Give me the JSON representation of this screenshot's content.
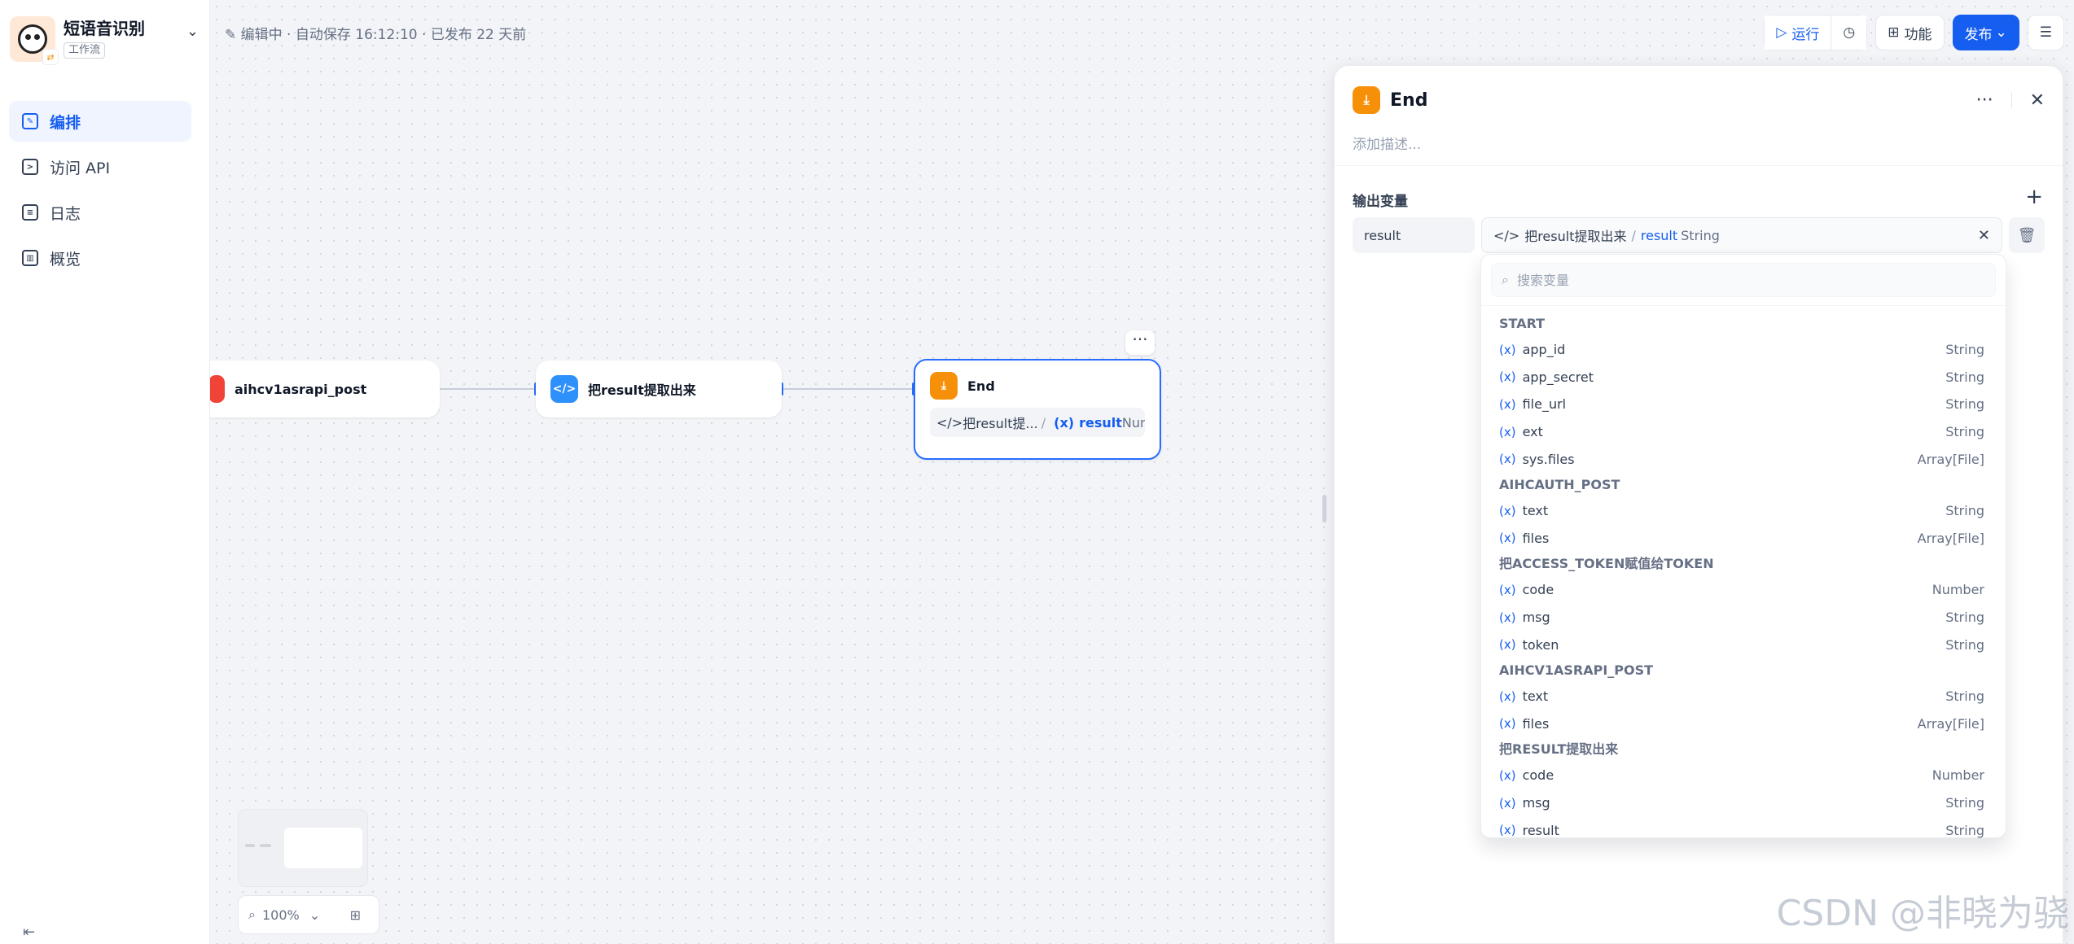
{
  "app": {
    "title": "短语音识别",
    "type_badge": "工作流"
  },
  "nav": [
    {
      "label": "编排",
      "icon": "orchestrate-icon",
      "active": true
    },
    {
      "label": "访问 API",
      "icon": "terminal-icon",
      "active": false
    },
    {
      "label": "日志",
      "icon": "log-icon",
      "active": false
    },
    {
      "label": "概览",
      "icon": "chart-icon",
      "active": false
    }
  ],
  "editor": {
    "status": "编辑中 · 自动保存 16:12:10 · 已发布 22 天前"
  },
  "toolbar": {
    "run_label": "运行",
    "features_label": "功能",
    "publish_label": "发布"
  },
  "nodes": {
    "http": {
      "title": "aihcv1asrapi_post"
    },
    "code": {
      "title": "把result提取出来"
    },
    "end": {
      "title": "End",
      "var_source": "把result提...",
      "var_name": "result",
      "var_type": "Number"
    }
  },
  "zoom": {
    "level": "100%"
  },
  "panel": {
    "title": "End",
    "description_placeholder": "添加描述...",
    "section_label": "输出变量",
    "output": {
      "name": "result",
      "source": "把result提取出来",
      "var": "result",
      "type": "String"
    }
  },
  "dropdown": {
    "search_placeholder": "搜索变量",
    "groups": [
      {
        "name": "START",
        "items": [
          {
            "name": "app_id",
            "type": "String"
          },
          {
            "name": "app_secret",
            "type": "String"
          },
          {
            "name": "file_url",
            "type": "String"
          },
          {
            "name": "ext",
            "type": "String"
          },
          {
            "name": "sys.files",
            "type": "Array[File]"
          }
        ]
      },
      {
        "name": "AIHCAUTH_POST",
        "items": [
          {
            "name": "text",
            "type": "String"
          },
          {
            "name": "files",
            "type": "Array[File]"
          }
        ]
      },
      {
        "name": "把ACCESS_TOKEN赋值给TOKEN",
        "items": [
          {
            "name": "code",
            "type": "Number"
          },
          {
            "name": "msg",
            "type": "String"
          },
          {
            "name": "token",
            "type": "String"
          }
        ]
      },
      {
        "name": "AIHCV1ASRAPI_POST",
        "items": [
          {
            "name": "text",
            "type": "String"
          },
          {
            "name": "files",
            "type": "Array[File]"
          }
        ]
      },
      {
        "name": "把RESULT提取出来",
        "items": [
          {
            "name": "code",
            "type": "Number"
          },
          {
            "name": "msg",
            "type": "String"
          },
          {
            "name": "result",
            "type": "String"
          }
        ]
      }
    ]
  },
  "watermark": "CSDN @非晓为骁",
  "colors": {
    "accent": "#155eef",
    "end_node": "#f79009",
    "code_node": "#2e90fa",
    "http_node": "#f04438"
  }
}
